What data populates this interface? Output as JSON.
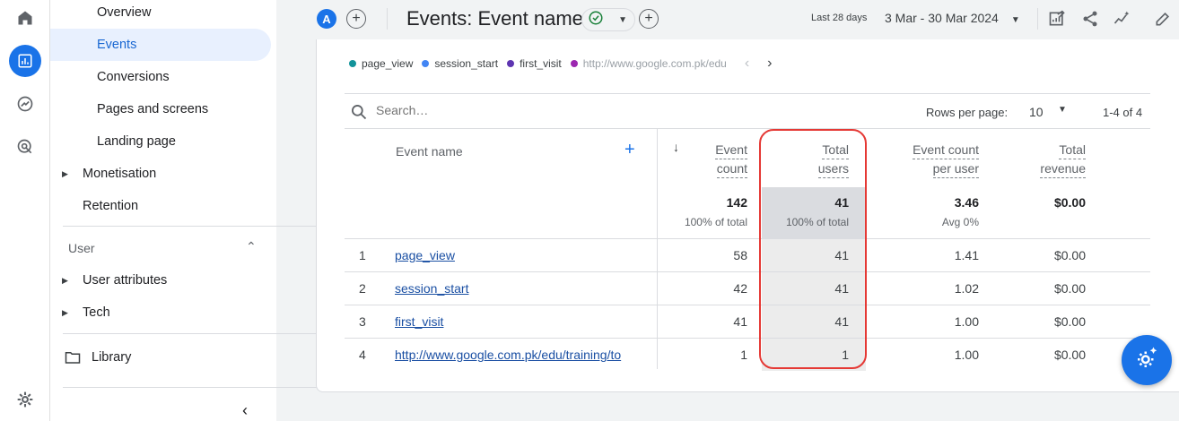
{
  "app": {
    "avatar_letter": "A",
    "title": "Events: Event name",
    "date_tag": "Last 28 days",
    "date_range": "3 Mar - 30 Mar 2024"
  },
  "colors": {
    "accent": "#1a73e8",
    "highlight": "#e53935"
  },
  "rail_icons": [
    "home-icon",
    "reports-icon",
    "explore-icon",
    "advertising-icon",
    "settings-icon"
  ],
  "nav": {
    "items": [
      {
        "label": "Overview"
      },
      {
        "label": "Events"
      },
      {
        "label": "Conversions"
      },
      {
        "label": "Pages and screens"
      },
      {
        "label": "Landing page"
      }
    ],
    "monetisation": "Monetisation",
    "retention": "Retention",
    "user_section": "User",
    "user_attributes": "User attributes",
    "tech": "Tech",
    "library": "Library"
  },
  "legend": [
    {
      "label": "page_view",
      "color": "#12939a"
    },
    {
      "label": "session_start",
      "color": "#4285f4"
    },
    {
      "label": "first_visit",
      "color": "#5e35b1"
    },
    {
      "label": "http://www.google.com.pk/edu",
      "color": "#9c27b0"
    }
  ],
  "table": {
    "search_placeholder": "Search…",
    "rows_per_page_label": "Rows per page:",
    "rows_per_page": "10",
    "pager": "1-4 of 4",
    "headers": {
      "event_name": "Event name",
      "event_count_1": "Event",
      "event_count_2": "count",
      "total_users_1": "Total",
      "total_users_2": "users",
      "ecpu_1": "Event count",
      "ecpu_2": "per user",
      "revenue_1": "Total",
      "revenue_2": "revenue"
    },
    "totals": {
      "event_count": "142",
      "event_count_sub": "100% of total",
      "total_users": "41",
      "total_users_sub": "100% of total",
      "ecpu": "3.46",
      "ecpu_sub": "Avg 0%",
      "revenue": "$0.00"
    },
    "rows": [
      {
        "idx": "1",
        "name": "page_view",
        "count": "58",
        "users": "41",
        "ecpu": "1.41",
        "revenue": "$0.00"
      },
      {
        "idx": "2",
        "name": "session_start",
        "count": "42",
        "users": "41",
        "ecpu": "1.02",
        "revenue": "$0.00"
      },
      {
        "idx": "3",
        "name": "first_visit",
        "count": "41",
        "users": "41",
        "ecpu": "1.00",
        "revenue": "$0.00"
      },
      {
        "idx": "4",
        "name": "http://www.google.com.pk/edu/training/to",
        "count": "1",
        "users": "1",
        "ecpu": "1.00",
        "revenue": "$0.00"
      }
    ]
  }
}
